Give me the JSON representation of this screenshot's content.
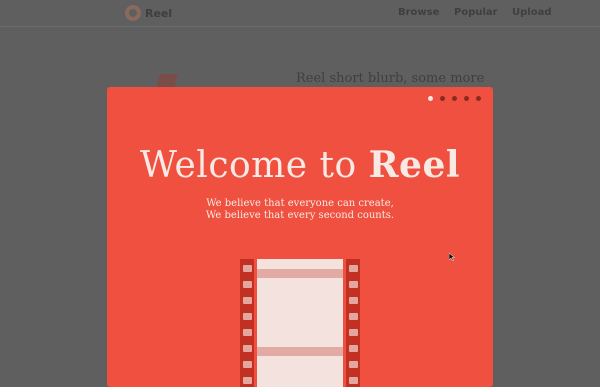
{
  "background": {
    "logo_text": "Reel",
    "nav": [
      "Browse",
      "Popular",
      "Upload"
    ],
    "blurb": "Reel short blurb, some more"
  },
  "modal": {
    "title_prefix": "Welcome to ",
    "title_brand": "Reel",
    "tagline_line1": "We believe that everyone can create,",
    "tagline_line2": "We believe that every second counts.",
    "pagination": {
      "total": 5,
      "active": 1
    }
  },
  "colors": {
    "modal_bg": "#f0503f",
    "overlay": "#5f5f5f",
    "film_side": "#c23024",
    "film_body": "#f3e2de"
  },
  "icons": [
    "logo-icon",
    "film-strip-illustration",
    "mouse-cursor-icon"
  ]
}
